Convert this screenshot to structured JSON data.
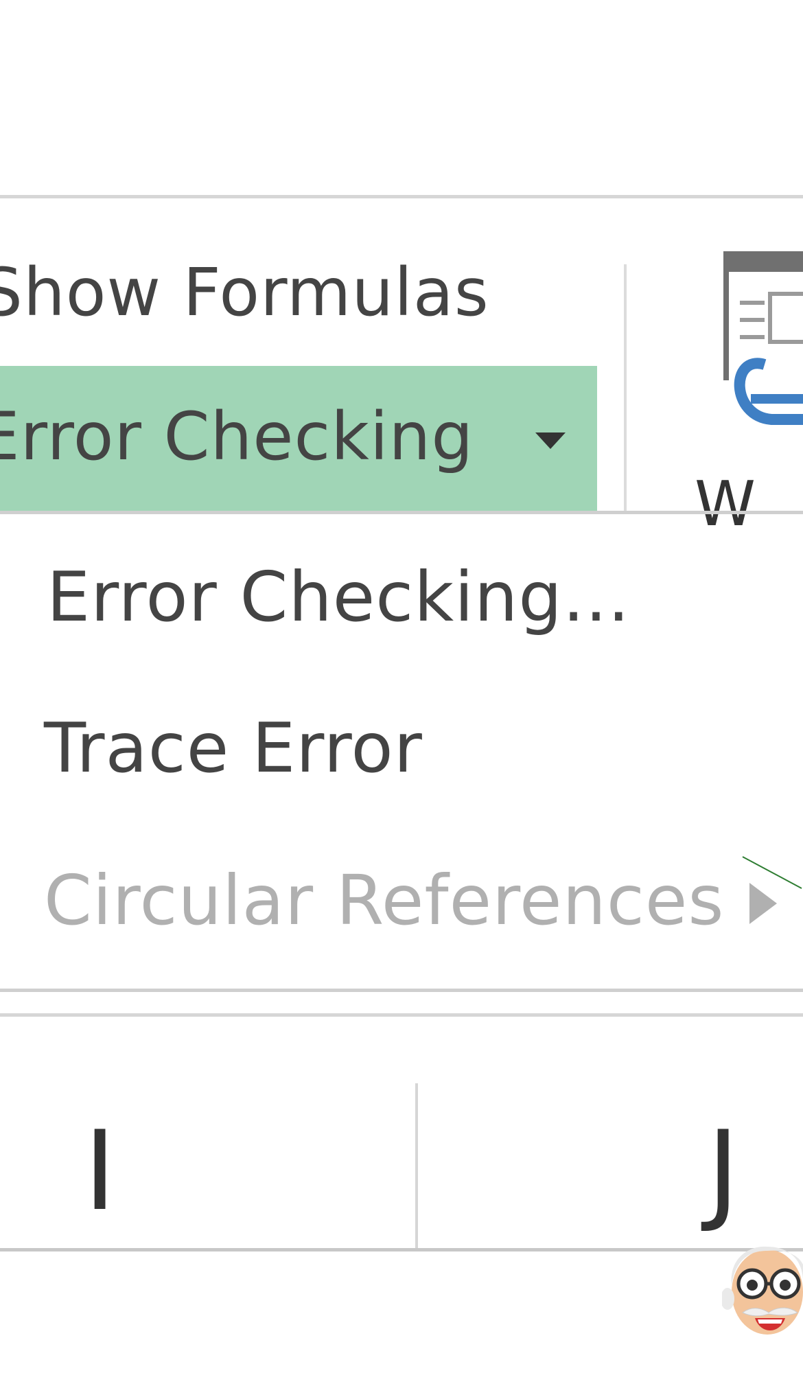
{
  "ribbon": {
    "show_formulas_label": "Show Formulas",
    "error_checking_label": "Error Checking",
    "watch_window_label": "W",
    "accent_color": "#a0d5b6"
  },
  "menu": {
    "items": [
      {
        "label": "Error Checking...",
        "enabled": true
      },
      {
        "label": "Trace Error",
        "enabled": true
      },
      {
        "label": "Circular References",
        "enabled": false,
        "has_submenu": true
      }
    ]
  },
  "sheet": {
    "columns": [
      "I",
      "J"
    ]
  },
  "icons": [
    "dropdown-arrow-icon",
    "watch-window-icon",
    "submenu-arrow-icon",
    "mascot-icon"
  ]
}
